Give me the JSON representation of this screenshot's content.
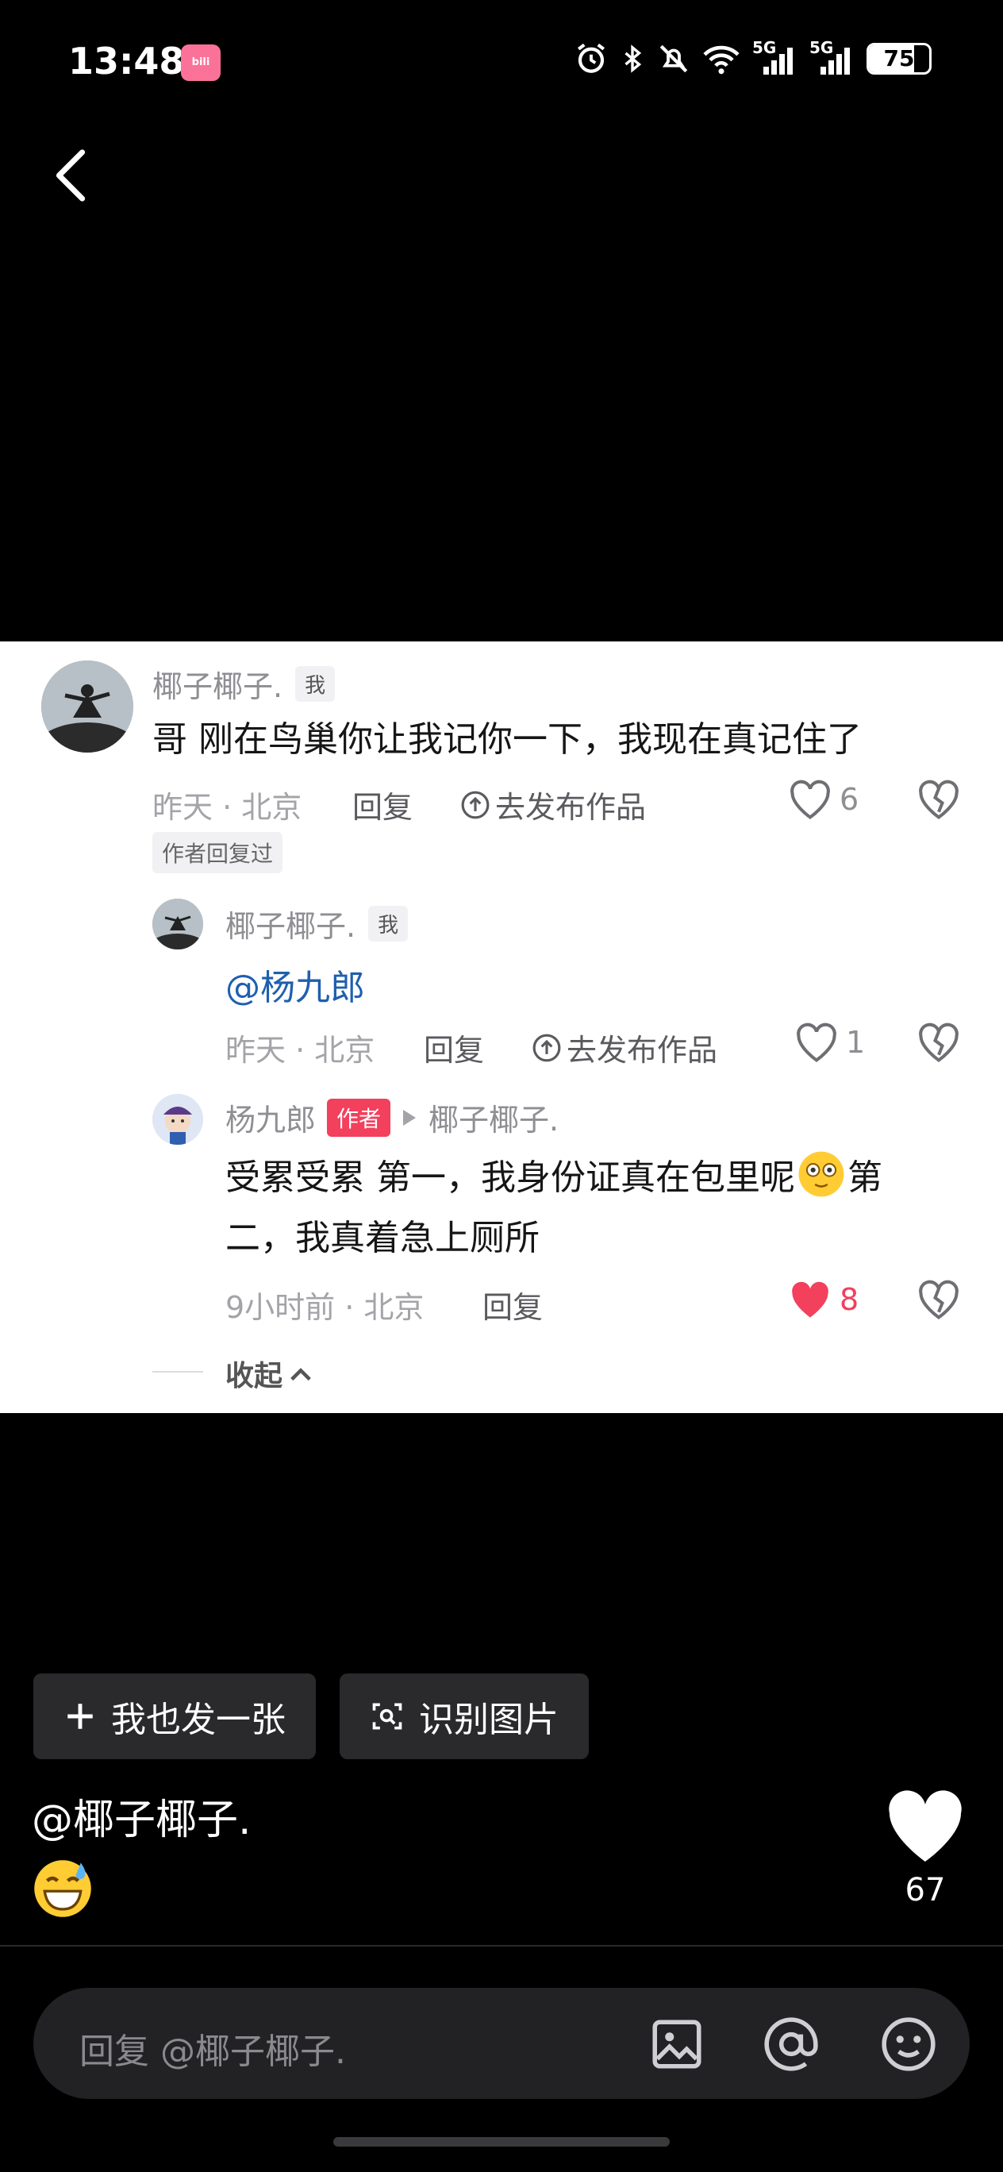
{
  "status_bar": {
    "time": "13:48",
    "app_badge": "bilibili",
    "battery": "75",
    "net1": "5G",
    "net2": "5G"
  },
  "comments": [
    {
      "username": "椰子椰子.",
      "tag": "我",
      "text": "哥 刚在鸟巢你让我记你一下，我现在真记住了",
      "time_location": "昨天 · 北京",
      "reply_label": "回复",
      "publish_label": "去发布作品",
      "likes": "6",
      "badge": "作者回复过"
    }
  ],
  "replies": [
    {
      "username": "椰子椰子.",
      "tag": "我",
      "text": "@杨九郎",
      "time_location": "昨天 · 北京",
      "reply_label": "回复",
      "publish_label": "去发布作品",
      "likes": "1"
    },
    {
      "username": "杨九郎",
      "tag": "作者",
      "reply_to": "椰子椰子.",
      "text_line1": "受累受累 第一，我身份证真在包里呢",
      "text_line1_tail": "第",
      "text_line2": "二，我真着急上厕所",
      "time_location": "9小时前 · 北京",
      "reply_label": "回复",
      "likes": "8",
      "liked": true
    }
  ],
  "collapse_label": "收起",
  "buttons": {
    "post_too": "我也发一张",
    "recognize": "识别图片"
  },
  "caption": {
    "mention": "@椰子椰子."
  },
  "post_likes": "67",
  "reply_input": {
    "placeholder": "回复 @椰子椰子."
  },
  "colors": {
    "liked_heart": "#f2405d",
    "author_tag": "#f2405d",
    "mention": "#1f5fae"
  }
}
